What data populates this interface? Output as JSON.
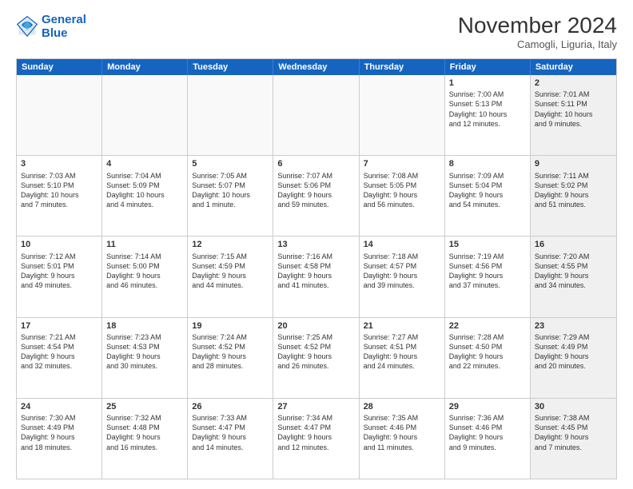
{
  "logo": {
    "line1": "General",
    "line2": "Blue"
  },
  "title": "November 2024",
  "location": "Camogli, Liguria, Italy",
  "header_days": [
    "Sunday",
    "Monday",
    "Tuesday",
    "Wednesday",
    "Thursday",
    "Friday",
    "Saturday"
  ],
  "rows": [
    [
      {
        "day": "",
        "info": "",
        "shaded": false,
        "empty": true
      },
      {
        "day": "",
        "info": "",
        "shaded": false,
        "empty": true
      },
      {
        "day": "",
        "info": "",
        "shaded": false,
        "empty": true
      },
      {
        "day": "",
        "info": "",
        "shaded": false,
        "empty": true
      },
      {
        "day": "",
        "info": "",
        "shaded": false,
        "empty": true
      },
      {
        "day": "1",
        "info": "Sunrise: 7:00 AM\nSunset: 5:13 PM\nDaylight: 10 hours\nand 12 minutes.",
        "shaded": false,
        "empty": false
      },
      {
        "day": "2",
        "info": "Sunrise: 7:01 AM\nSunset: 5:11 PM\nDaylight: 10 hours\nand 9 minutes.",
        "shaded": true,
        "empty": false
      }
    ],
    [
      {
        "day": "3",
        "info": "Sunrise: 7:03 AM\nSunset: 5:10 PM\nDaylight: 10 hours\nand 7 minutes.",
        "shaded": false,
        "empty": false
      },
      {
        "day": "4",
        "info": "Sunrise: 7:04 AM\nSunset: 5:09 PM\nDaylight: 10 hours\nand 4 minutes.",
        "shaded": false,
        "empty": false
      },
      {
        "day": "5",
        "info": "Sunrise: 7:05 AM\nSunset: 5:07 PM\nDaylight: 10 hours\nand 1 minute.",
        "shaded": false,
        "empty": false
      },
      {
        "day": "6",
        "info": "Sunrise: 7:07 AM\nSunset: 5:06 PM\nDaylight: 9 hours\nand 59 minutes.",
        "shaded": false,
        "empty": false
      },
      {
        "day": "7",
        "info": "Sunrise: 7:08 AM\nSunset: 5:05 PM\nDaylight: 9 hours\nand 56 minutes.",
        "shaded": false,
        "empty": false
      },
      {
        "day": "8",
        "info": "Sunrise: 7:09 AM\nSunset: 5:04 PM\nDaylight: 9 hours\nand 54 minutes.",
        "shaded": false,
        "empty": false
      },
      {
        "day": "9",
        "info": "Sunrise: 7:11 AM\nSunset: 5:02 PM\nDaylight: 9 hours\nand 51 minutes.",
        "shaded": true,
        "empty": false
      }
    ],
    [
      {
        "day": "10",
        "info": "Sunrise: 7:12 AM\nSunset: 5:01 PM\nDaylight: 9 hours\nand 49 minutes.",
        "shaded": false,
        "empty": false
      },
      {
        "day": "11",
        "info": "Sunrise: 7:14 AM\nSunset: 5:00 PM\nDaylight: 9 hours\nand 46 minutes.",
        "shaded": false,
        "empty": false
      },
      {
        "day": "12",
        "info": "Sunrise: 7:15 AM\nSunset: 4:59 PM\nDaylight: 9 hours\nand 44 minutes.",
        "shaded": false,
        "empty": false
      },
      {
        "day": "13",
        "info": "Sunrise: 7:16 AM\nSunset: 4:58 PM\nDaylight: 9 hours\nand 41 minutes.",
        "shaded": false,
        "empty": false
      },
      {
        "day": "14",
        "info": "Sunrise: 7:18 AM\nSunset: 4:57 PM\nDaylight: 9 hours\nand 39 minutes.",
        "shaded": false,
        "empty": false
      },
      {
        "day": "15",
        "info": "Sunrise: 7:19 AM\nSunset: 4:56 PM\nDaylight: 9 hours\nand 37 minutes.",
        "shaded": false,
        "empty": false
      },
      {
        "day": "16",
        "info": "Sunrise: 7:20 AM\nSunset: 4:55 PM\nDaylight: 9 hours\nand 34 minutes.",
        "shaded": true,
        "empty": false
      }
    ],
    [
      {
        "day": "17",
        "info": "Sunrise: 7:21 AM\nSunset: 4:54 PM\nDaylight: 9 hours\nand 32 minutes.",
        "shaded": false,
        "empty": false
      },
      {
        "day": "18",
        "info": "Sunrise: 7:23 AM\nSunset: 4:53 PM\nDaylight: 9 hours\nand 30 minutes.",
        "shaded": false,
        "empty": false
      },
      {
        "day": "19",
        "info": "Sunrise: 7:24 AM\nSunset: 4:52 PM\nDaylight: 9 hours\nand 28 minutes.",
        "shaded": false,
        "empty": false
      },
      {
        "day": "20",
        "info": "Sunrise: 7:25 AM\nSunset: 4:52 PM\nDaylight: 9 hours\nand 26 minutes.",
        "shaded": false,
        "empty": false
      },
      {
        "day": "21",
        "info": "Sunrise: 7:27 AM\nSunset: 4:51 PM\nDaylight: 9 hours\nand 24 minutes.",
        "shaded": false,
        "empty": false
      },
      {
        "day": "22",
        "info": "Sunrise: 7:28 AM\nSunset: 4:50 PM\nDaylight: 9 hours\nand 22 minutes.",
        "shaded": false,
        "empty": false
      },
      {
        "day": "23",
        "info": "Sunrise: 7:29 AM\nSunset: 4:49 PM\nDaylight: 9 hours\nand 20 minutes.",
        "shaded": true,
        "empty": false
      }
    ],
    [
      {
        "day": "24",
        "info": "Sunrise: 7:30 AM\nSunset: 4:49 PM\nDaylight: 9 hours\nand 18 minutes.",
        "shaded": false,
        "empty": false
      },
      {
        "day": "25",
        "info": "Sunrise: 7:32 AM\nSunset: 4:48 PM\nDaylight: 9 hours\nand 16 minutes.",
        "shaded": false,
        "empty": false
      },
      {
        "day": "26",
        "info": "Sunrise: 7:33 AM\nSunset: 4:47 PM\nDaylight: 9 hours\nand 14 minutes.",
        "shaded": false,
        "empty": false
      },
      {
        "day": "27",
        "info": "Sunrise: 7:34 AM\nSunset: 4:47 PM\nDaylight: 9 hours\nand 12 minutes.",
        "shaded": false,
        "empty": false
      },
      {
        "day": "28",
        "info": "Sunrise: 7:35 AM\nSunset: 4:46 PM\nDaylight: 9 hours\nand 11 minutes.",
        "shaded": false,
        "empty": false
      },
      {
        "day": "29",
        "info": "Sunrise: 7:36 AM\nSunset: 4:46 PM\nDaylight: 9 hours\nand 9 minutes.",
        "shaded": false,
        "empty": false
      },
      {
        "day": "30",
        "info": "Sunrise: 7:38 AM\nSunset: 4:45 PM\nDaylight: 9 hours\nand 7 minutes.",
        "shaded": true,
        "empty": false
      }
    ]
  ]
}
